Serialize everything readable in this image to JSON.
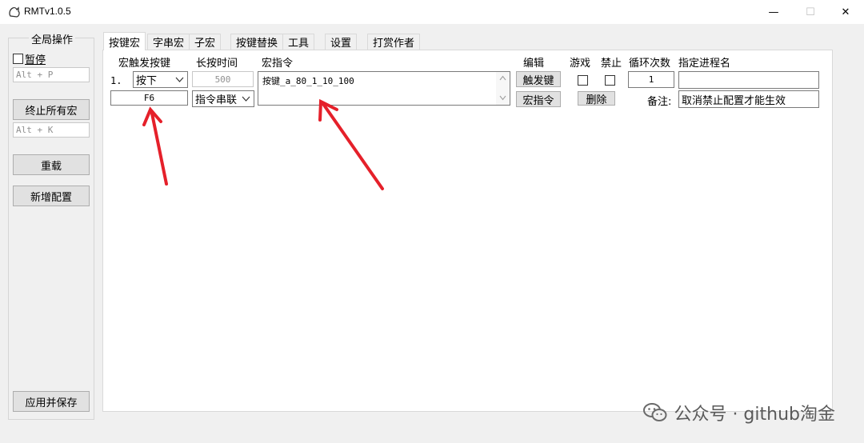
{
  "window": {
    "title": "RMTv1.0.5",
    "minimize": "—",
    "maximize": "☐",
    "close": "✕"
  },
  "global": {
    "group_title": "全局操作",
    "pause_label": "暂停",
    "pause_hotkey": "Alt + P",
    "stop_all": "终止所有宏",
    "stop_hotkey": "Alt + K",
    "reload": "重载",
    "add_config": "新增配置",
    "apply_save": "应用并保存"
  },
  "tabs": [
    "按键宏",
    "字串宏",
    "子宏",
    "按键替换",
    "工具",
    "设置",
    "打赏作者"
  ],
  "headers": {
    "trigger_key": "宏触发按键",
    "hold_time": "长按时间",
    "macro_cmd": "宏指令",
    "edit": "编辑",
    "game": "游戏",
    "disable": "禁止",
    "loop_count": "循环次数",
    "process_name": "指定进程名"
  },
  "row": {
    "index": "1.",
    "trigger_mode": "按下",
    "trigger_key": "F6",
    "hold_time": "500",
    "cmd_mode": "指令串联",
    "macro_cmd": "按键_a_80_1_10_100",
    "edit_trigger_btn": "触发键",
    "edit_macro_btn": "宏指令",
    "delete_btn": "删除",
    "loop_count": "1",
    "process_name": "",
    "remark_label": "备注:",
    "remark": "取消禁止配置才能生效"
  },
  "watermark": {
    "text": "公众号 · github淘金"
  }
}
